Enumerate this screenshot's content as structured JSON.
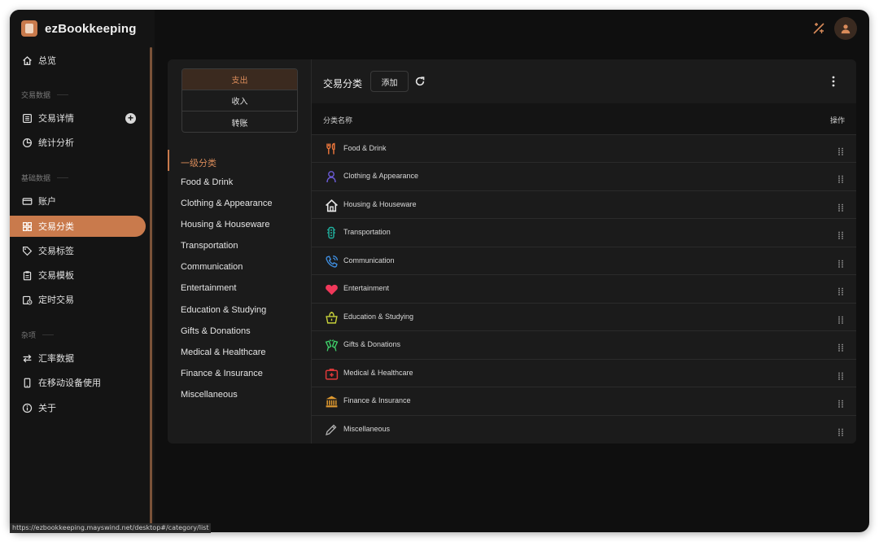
{
  "app": {
    "name": "ezBookkeeping"
  },
  "sidebar": {
    "overview": "总览",
    "group_transactions": "交易数据",
    "transaction_details": "交易详情",
    "statistics": "统计分析",
    "group_basic": "基础数据",
    "accounts": "账户",
    "categories": "交易分类",
    "tags": "交易标签",
    "templates": "交易模板",
    "scheduled": "定时交易",
    "group_misc": "杂项",
    "exchange_rates": "汇率数据",
    "mobile": "在移动设备使用",
    "about": "关于"
  },
  "type_tabs": [
    "支出",
    "收入",
    "转账"
  ],
  "primary_category_label": "一级分类",
  "category_list": [
    "Food & Drink",
    "Clothing & Appearance",
    "Housing & Houseware",
    "Transportation",
    "Communication",
    "Entertainment",
    "Education & Studying",
    "Gifts & Donations",
    "Medical & Healthcare",
    "Finance & Insurance",
    "Miscellaneous"
  ],
  "panel": {
    "title": "交易分类",
    "add_button": "添加",
    "col_name": "分类名称",
    "col_actions": "操作"
  },
  "rows": [
    {
      "name": "Food & Drink",
      "icon": "utensils-icon",
      "color": "#f0783c"
    },
    {
      "name": "Clothing & Appearance",
      "icon": "person-icon",
      "color": "#6b5bd6"
    },
    {
      "name": "Housing & Houseware",
      "icon": "house-icon",
      "color": "#e6e6e6"
    },
    {
      "name": "Transportation",
      "icon": "traffic-light-icon",
      "color": "#20b2a0"
    },
    {
      "name": "Communication",
      "icon": "phone-icon",
      "color": "#3f8ee0"
    },
    {
      "name": "Entertainment",
      "icon": "heart-icon",
      "color": "#f0385a"
    },
    {
      "name": "Education & Studying",
      "icon": "graduation-icon",
      "color": "#c8d23a"
    },
    {
      "name": "Gifts & Donations",
      "icon": "gift-icon",
      "color": "#3fd06a"
    },
    {
      "name": "Medical & Healthcare",
      "icon": "medical-kit-icon",
      "color": "#e03a3a"
    },
    {
      "name": "Finance & Insurance",
      "icon": "bank-icon",
      "color": "#e09a30"
    },
    {
      "name": "Miscellaneous",
      "icon": "pencil-icon",
      "color": "#b0b0b0"
    }
  ],
  "status_url": "https://ezbookkeeping.mayswind.net/desktop#/category/list",
  "accent_color": "#c97a4c"
}
